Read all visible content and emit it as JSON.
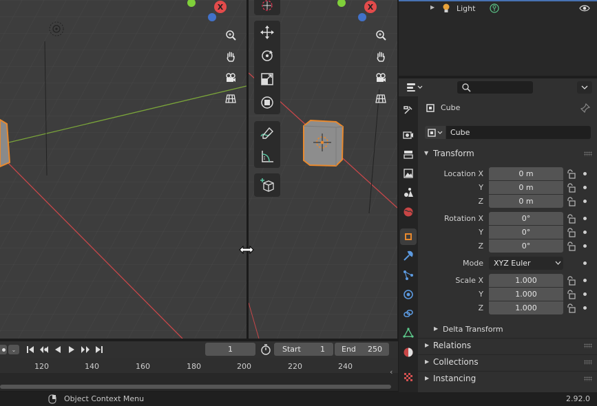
{
  "outliner": {
    "row_label": "Light",
    "row_icon": "light-bulb-icon"
  },
  "timeline": {
    "current_frame": "1",
    "start_label": "Start",
    "start_value": "1",
    "end_label": "End",
    "end_value": "250",
    "ticks": [
      "120",
      "140",
      "160",
      "180",
      "200",
      "220",
      "240"
    ]
  },
  "status": {
    "hint": "Object Context Menu",
    "version": "2.92.0"
  },
  "viewport": {
    "gizmo_x_label": "X",
    "gizmo_x_label_2": "X"
  },
  "properties": {
    "object_name": "Cube",
    "datablock_name": "Cube",
    "transform_header": "Transform",
    "location_x_label": "Location X",
    "location_y_label": "Y",
    "location_z_label": "Z",
    "location_x": "0 m",
    "location_y": "0 m",
    "location_z": "0 m",
    "rotation_x_label": "Rotation X",
    "rotation_y_label": "Y",
    "rotation_z_label": "Z",
    "rotation_x": "0°",
    "rotation_y": "0°",
    "rotation_z": "0°",
    "mode_label": "Mode",
    "mode_value": "XYZ Euler",
    "scale_x_label": "Scale X",
    "scale_y_label": "Y",
    "scale_z_label": "Z",
    "scale_x": "1.000",
    "scale_y": "1.000",
    "scale_z": "1.000",
    "delta_transform": "Delta Transform",
    "relations": "Relations",
    "collections": "Collections",
    "instancing": "Instancing"
  },
  "colors": {
    "accent_orange": "#e8892e",
    "axis_red": "#c8474a",
    "axis_green": "#7ba63a",
    "gizmo_red": "#e34b4b",
    "gizmo_green": "#7fcf3a",
    "gizmo_blue": "#4272c9"
  }
}
